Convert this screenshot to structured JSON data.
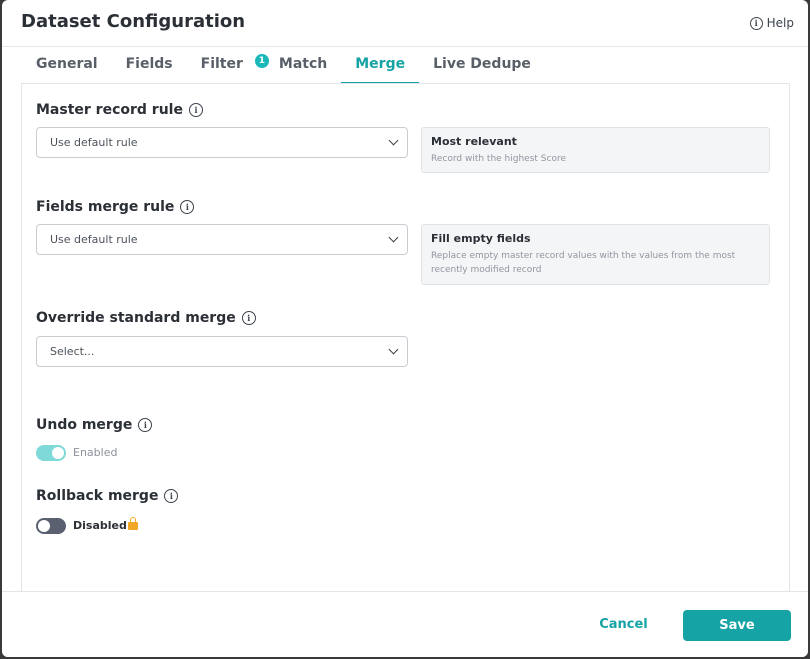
{
  "dialog": {
    "title": "Dataset Configuration",
    "help_label": "Help"
  },
  "tabs": [
    {
      "label": "General"
    },
    {
      "label": "Fields"
    },
    {
      "label": "Filter",
      "badge": "1"
    },
    {
      "label": "Match"
    },
    {
      "label": "Merge",
      "active": true
    },
    {
      "label": "Live Dedupe"
    }
  ],
  "master_record": {
    "label": "Master record rule",
    "selected": "Use default rule",
    "desc_title": "Most relevant",
    "desc_text": "Record with the highest Score"
  },
  "fields_merge": {
    "label": "Fields merge rule",
    "selected": "Use default rule",
    "desc_title": "Fill empty fields",
    "desc_text": "Replace empty master record values with the values from the most recently modified record"
  },
  "override_merge": {
    "label": "Override standard merge",
    "placeholder": "Select..."
  },
  "undo_merge": {
    "label": "Undo merge",
    "state": "Enabled",
    "on": true
  },
  "rollback_merge": {
    "label": "Rollback merge",
    "state": "Disabled",
    "on": false,
    "locked": true
  },
  "footer": {
    "cancel_label": "Cancel",
    "save_label": "Save"
  },
  "colors": {
    "accent": "#15a3a5",
    "toggle_on": "#7fd9d9",
    "toggle_off": "#5a6070",
    "lock": "#f2a626"
  }
}
